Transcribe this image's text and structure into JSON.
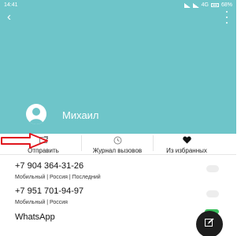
{
  "status_bar": {
    "time": "14:41",
    "network": "4G",
    "battery": "68%"
  },
  "contact": {
    "name": "Михаил"
  },
  "actions": [
    {
      "label": "Отправить",
      "icon": "send-message-icon"
    },
    {
      "label": "Журнал вызовов",
      "icon": "clock-icon"
    },
    {
      "label": "Из избранных",
      "icon": "heart-icon"
    }
  ],
  "phones": [
    {
      "number": "+7 904 364-31-26",
      "meta": "Мобильный  |  Россия  |  Последний"
    },
    {
      "number": "+7 951 701-94-97",
      "meta": "Мобильный  |  Россия"
    }
  ],
  "apps": [
    {
      "label": "WhatsApp"
    }
  ],
  "colors": {
    "header": "#6ec5c9",
    "annotation_arrow": "#e0141c",
    "fab": "#1e1e1e"
  }
}
